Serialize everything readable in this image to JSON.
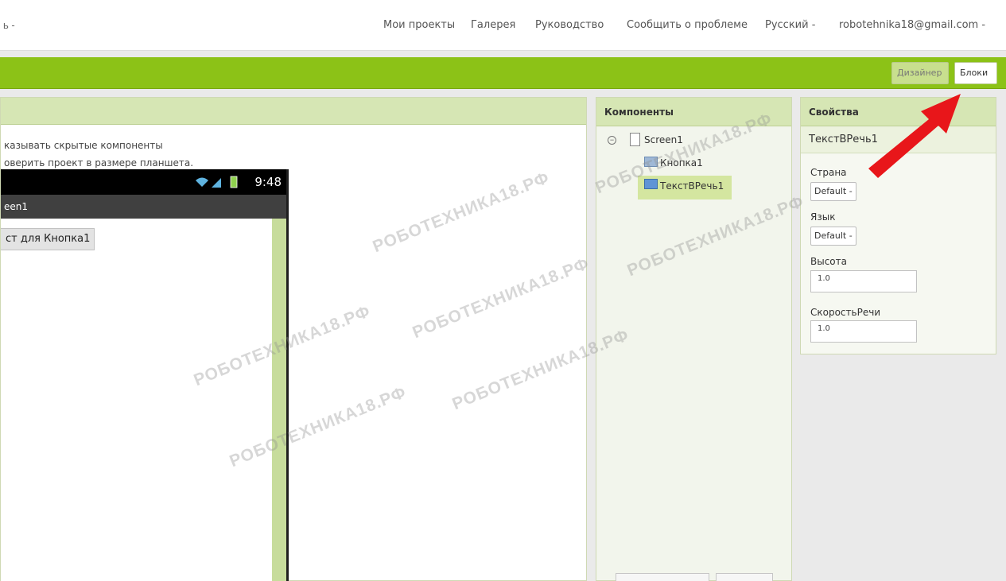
{
  "topnav": {
    "left_stub": "ь -",
    "items": [
      {
        "label": "Мои проекты"
      },
      {
        "label": "Галерея"
      },
      {
        "label": "Руководство"
      },
      {
        "label": "Сообщить о проблеме"
      },
      {
        "label": "Русский -"
      },
      {
        "label": "robotehnika18@gmail.com -"
      }
    ]
  },
  "toolbar": {
    "designer_label": "Дизайнер",
    "blocks_label": "Блоки"
  },
  "viewer": {
    "show_hidden": "казывать скрытые компоненты",
    "tablet_preview": "оверить проект в размере планшета."
  },
  "phone": {
    "time": "9:48",
    "screen_title": "een1",
    "button_text": "ст для Кнопка1"
  },
  "components": {
    "title": "Компоненты",
    "tree": [
      {
        "label": "Screen1"
      },
      {
        "label": "Кнопка1"
      },
      {
        "label": "ТекстВРечь1"
      }
    ]
  },
  "properties": {
    "title": "Свойства",
    "selected": "ТекстВРечь1",
    "fields": [
      {
        "label": "Страна",
        "value": "Default -"
      },
      {
        "label": "Язык",
        "value": "Default -"
      },
      {
        "label": "Высота",
        "value": "1.0"
      },
      {
        "label": "СкоростьРечи",
        "value": "1.0"
      }
    ]
  },
  "watermark": "РОБОТЕХНИКА18.РФ",
  "colors": {
    "toolbar_green": "#8cc217",
    "panel_head": "#d6e6b4",
    "selection": "#d4e6a0",
    "annotation_arrow": "#e8161a"
  },
  "annotation": {
    "icon": "red-arrow-icon"
  }
}
